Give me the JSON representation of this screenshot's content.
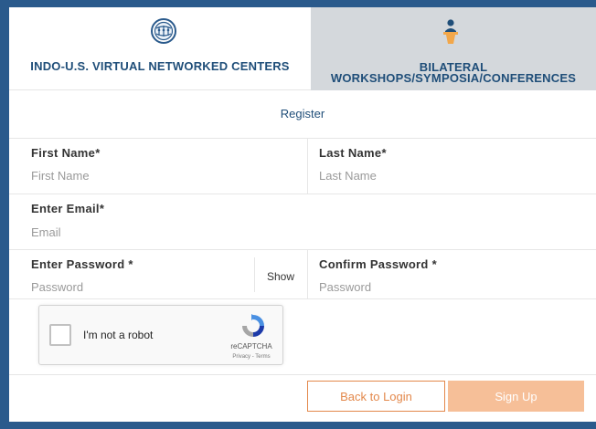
{
  "tabs": {
    "left_label": "INDO-U.S. VIRTUAL NETWORKED CENTERS",
    "right_label_line1": "BILATERAL",
    "right_label_line2": "WORKSHOPS/SYMPOSIA/CONFERENCES"
  },
  "form": {
    "title": "Register",
    "first_name": {
      "label": "First Name*",
      "placeholder": "First Name"
    },
    "last_name": {
      "label": "Last Name*",
      "placeholder": "Last Name"
    },
    "email": {
      "label": "Enter Email*",
      "placeholder": "Email"
    },
    "password": {
      "label": "Enter Password *",
      "placeholder": "Password",
      "show_label": "Show"
    },
    "confirm_password": {
      "label": "Confirm Password *",
      "placeholder": "Password"
    }
  },
  "captcha": {
    "label": "I'm not a robot",
    "brand": "reCAPTCHA",
    "links": "Privacy - Terms"
  },
  "buttons": {
    "back_label": "Back to Login",
    "signup_label": "Sign Up"
  },
  "colors": {
    "brand_blue": "#1f4e79",
    "accent_orange": "#e3884b",
    "signup_disabled": "#f6bf98"
  },
  "icons": {
    "left_tab": "network-globe-icon",
    "right_tab": "speaker-podium-icon",
    "captcha": "recaptcha-logo-icon"
  }
}
